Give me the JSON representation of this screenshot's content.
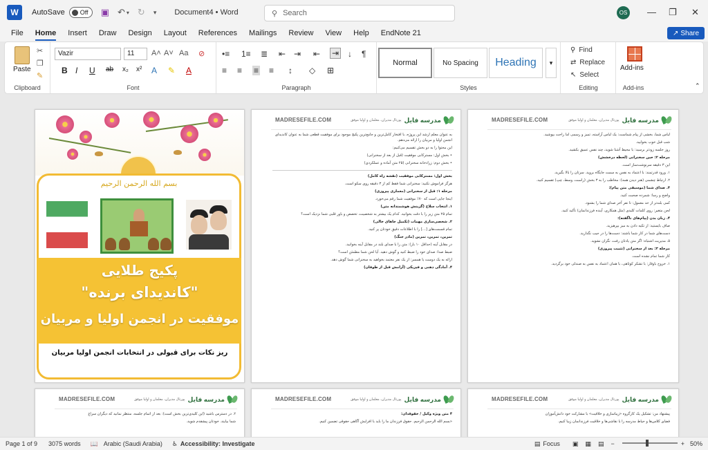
{
  "titlebar": {
    "autosave_label": "AutoSave",
    "autosave_state": "Off",
    "doc_title": "Document4 • Word",
    "search_placeholder": "Search",
    "avatar": "OS"
  },
  "tabs": [
    "File",
    "Home",
    "Insert",
    "Draw",
    "Design",
    "Layout",
    "References",
    "Mailings",
    "Review",
    "View",
    "Help",
    "EndNote 21"
  ],
  "share_label": "Share",
  "ribbon": {
    "clipboard": {
      "paste": "Paste",
      "label": "Clipboard"
    },
    "font": {
      "name": "Vazir",
      "size": "11",
      "label": "Font",
      "grow": "A˄",
      "shrink": "A˅",
      "case": "Aa",
      "bold": "B",
      "italic": "I",
      "underline": "U",
      "strike": "ab",
      "sub": "x₂",
      "sup": "x²",
      "color": "A"
    },
    "paragraph": {
      "label": "Paragraph",
      "pilcrow": "¶",
      "sort": "↓",
      "indent_in": "⇥",
      "indent_out": "⇤",
      "align_left": "≡",
      "align_center": "≡",
      "align_right": "≡",
      "justify": "≡",
      "spacing": "↕",
      "shading": "◇",
      "borders": "⊞",
      "bullets": "•≡",
      "numbering": "1≡",
      "multilevel": "≣"
    },
    "styles": {
      "label": "Styles",
      "items": [
        "Normal",
        "No Spacing",
        "Heading"
      ],
      "heading_color": "#2e74b5"
    },
    "editing": {
      "label": "Editing",
      "find": "Find",
      "replace": "Replace",
      "select": "Select"
    },
    "addins": {
      "label": "Add-ins",
      "button": "Add-ins"
    }
  },
  "pages": {
    "header_site": "MADRESEFILE.COM",
    "header_brand": "مدرسه فایل",
    "header_sub": "پورتال مدیران، معلمان و اولیا موفق",
    "middle_lines": [
      "به عنوان معلم ارشد این پروژه، با افتخار کامل‌ترین و جامع‌ترین پکیج موجود برای موفقیت قطعی شما به عنوان کاندیدای انجمن اولیا و مربیان را ارائه می‌دهم.",
      "این محتوا را به دو بخش تقسیم می‌کنیم:",
      "• بخش اول: مسترکابی موفقیت (قبل از بعد از سخنرانی)",
      "• بخش دوم: زرادخانه سخنرانی (۲۵ متن آماده و عملکردی)",
      "بخش اول: مسترکابی موفقیت (نقشه راه کامل)",
      "هرگز فراموش نکنید: سخنرانی شما فقط کم از ۳ دقیقه روی سکو است.",
      "مرحله ۱: قبل از سخنرانی (معماری پیروزی)",
      "اینجا جایی است که ۷۰٪ موفقیت شما رقم می‌خورد.",
      "۱. انتخاب سلاح (گزینش هوشمندانه متن)",
      "تمام ۲۵ متن زیر را با دقت بخوانید. کدام یک بیشتر به شخصیت، تخصص و باور قلبی شما نزدیک است؟",
      "۲. شخصی‌سازی مهمات (تکمیل جاهای خالی)",
      "تمام قسمت‌های [...] را با اطلاعات دقیق خودتان پر کنید.",
      "تمرین، تمرین، تمرین (مادر جنگ)",
      "در مقابل آینه (حداقل ۱۰ بار): متن را با صدای بلند در مقابل آینه بخوانید.",
      "ضبط صدا: صدای خود را ضبط کنید و گوش دهید. آیا لحن شما مطمئن است؟",
      "ارائه به یک دوست یا همسر: از یک نفر معتمد بخواهید به سخنرانی شما گوش دهد.",
      "۴. آمادگی ذهنی و فیزیکی (آرامش قبل از طوفان)"
    ],
    "right_lines": [
      "لباس شما، بخشی از پیام شماست: یک لباس آراسته، تمیز و رسمی اما راحت بپوشید.",
      "شب قبل خوب بخوابید.",
      "روز جلسه زودتر برسید: با محیط آشنا شوید، چند نفس عمیق بکشید.",
      "مرحله ۲: حین سخنرانی (لحظه درخشش)",
      "این ۳ دقیقه سرنوشت‌ساز است.",
      "۱. ورود قدرتمند: با اعتماد به نفس به سمت جایگاه بروید. سرتان را بالا بگیرید.",
      "۲. ارتباط چشمی (هنر دیدن همه): مخاطب را به ۳ بخش (راست، وسط، چپ) تقسیم کنید.",
      "۳. صدای شما (موسیقی متن پیام):",
      "واضح و رسا: شمرده صحبت کنید.",
      "کمی بلندتر از حد معمول: تا نفر آخر صدای شما را بشنود.",
      "لحن متغیر: روی کلمات کلیدی (مثل همکاری، آینده فرزندانمان) تأکید کنید.",
      "۴. زبان بدن (پیام‌های ناگفته):",
      "صاف بایستید: از تکیه دادن به میز بپرهیزید.",
      "دست‌های شما در کار شما باشند: دست‌ها را در جیب نگذارید.",
      "۵. مدیریت اشتباه: اگر متن یادتان رفت، نگران نشوید.",
      "مرحله ۳: بعد از سخنرانی (تثبیت پیروزی)",
      "کار شما تمام نشده است.",
      "۱. خروج باوقار: با تشکر کوتاهی، با همان اعتماد به نفس به صندلی خود برگردید."
    ],
    "bottom1_lines": [
      "۲. در دسترس باشید (این کلیدی‌ترین بخش است): بعد از اتمام جلسه، منتظر نمانید که دیگران سراغ",
      "شما بیایند. خودتان پیشقدم شوید."
    ],
    "bottom2_lines": [
      "۴ متن ویژه وکیل / حقوقدان:",
      "«بسم الله الرحمن الرحیم. حقوق فرزندان ما را باید با افزایش آگاهی حقوقی تضمین کنیم."
    ],
    "bottom3_lines": [
      "پیشنهاد من: تشکیل یک کارگروه «زیباسازی و خلاقیت» با مشارکت خود دانش‌آموزان",
      "فضای کلاس‌ها و حیاط مدرسه را با نقاشی‌ها و خلاقیت فرزندانمان زیبا کنیم."
    ]
  },
  "cover": {
    "bismillah": "بسم الله الرحمن الرحیم",
    "line1": "پکیج طلایی",
    "line2": "\"کاندیدای برنده\"",
    "line3": "موفقیت در انجمن اولیا و مربیان",
    "footer": "ریز نکات برای قبولی در انتخابات انجمن اولیا مربیان"
  },
  "status": {
    "page": "Page 1 of 9",
    "words": "3075 words",
    "language": "Arabic (Saudi Arabia)",
    "accessibility": "Accessibility: Investigate",
    "focus": "Focus",
    "zoom": "50%"
  }
}
